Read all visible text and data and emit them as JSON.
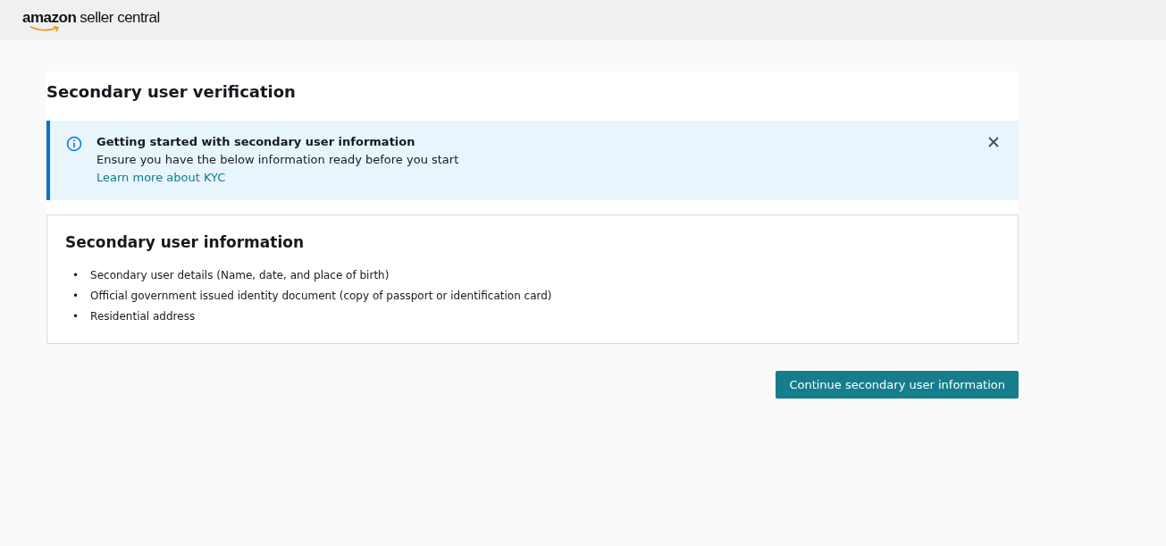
{
  "header": {
    "logo_brand": "amazon",
    "logo_product": "seller central"
  },
  "page": {
    "title": "Secondary user verification"
  },
  "alert": {
    "title": "Getting started with secondary user information",
    "message": "Ensure you have the below information ready before you start",
    "link": "Learn more about KYC"
  },
  "info_card": {
    "title": "Secondary user information",
    "items": [
      {
        "marker": "•",
        "text": "Secondary user details (Name, date, and place of birth)"
      },
      {
        "marker": "•",
        "text": "Official government issued identity document (copy of passport or identification card)"
      },
      {
        "marker": "•",
        "text": "Residential address"
      }
    ]
  },
  "buttons": [
    "Continue secondary user information"
  ]
}
